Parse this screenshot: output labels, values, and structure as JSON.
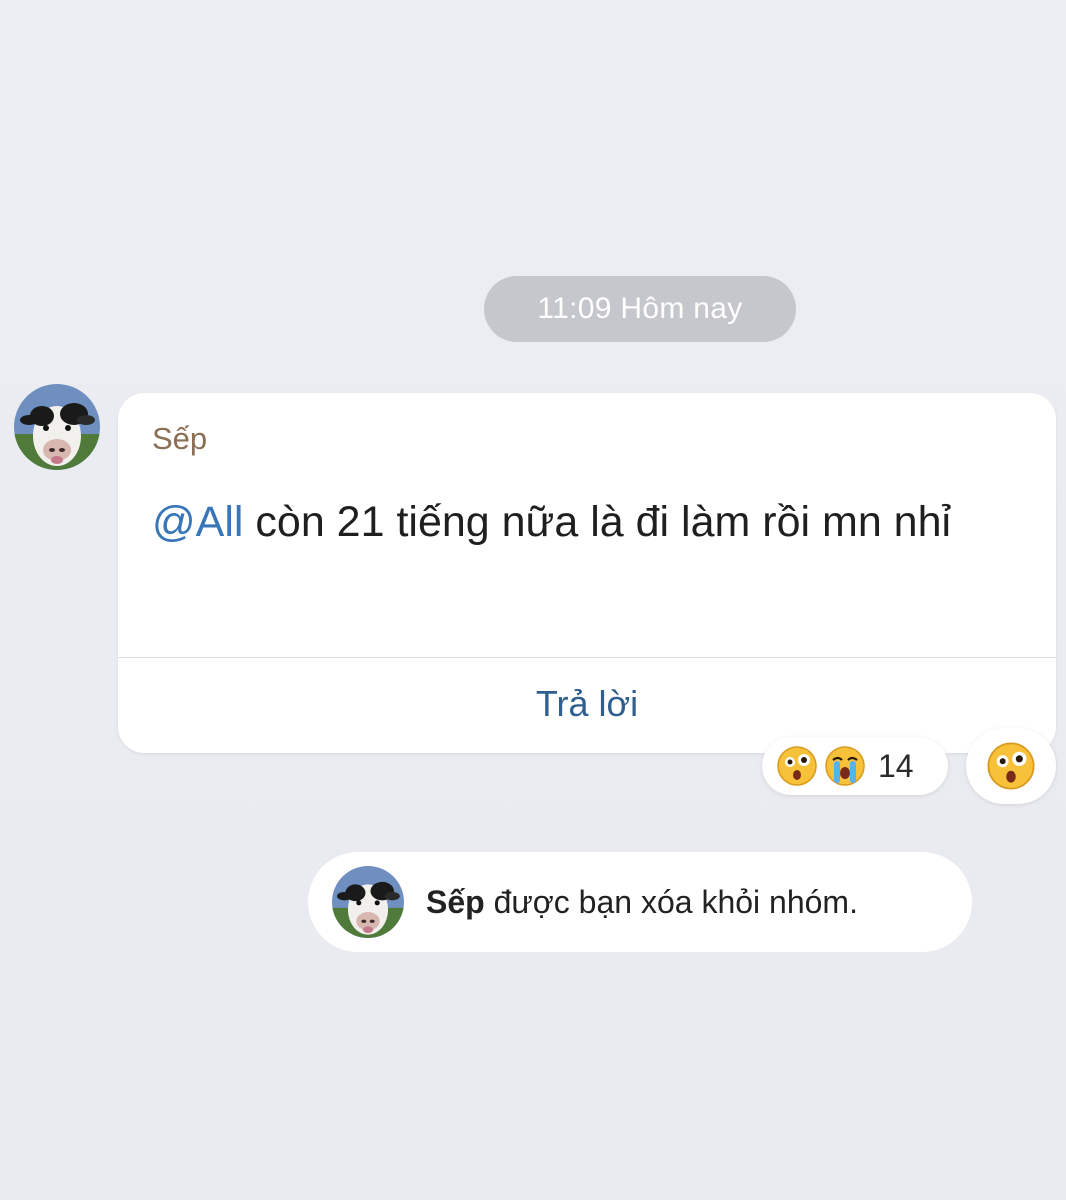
{
  "time_divider": "11:09 Hôm nay",
  "message": {
    "sender": "Sếp",
    "mention": "@All",
    "text": " còn 21 tiếng nữa là đi làm rồi mn nhỉ",
    "reply_label": "Trả lời"
  },
  "reactions": {
    "icons": [
      "surprised-face-icon",
      "crying-face-icon"
    ],
    "count": "14",
    "add_reaction_icon": "surprised-face-icon"
  },
  "system_notice": {
    "name": "Sếp",
    "text": " được bạn xóa khỏi nhóm."
  },
  "colors": {
    "background": "#e9ebf1",
    "time_pill": "#c5c7cd",
    "mention": "#3876b8",
    "sender_name": "#8a6f55",
    "reply": "#2f5f8e"
  }
}
